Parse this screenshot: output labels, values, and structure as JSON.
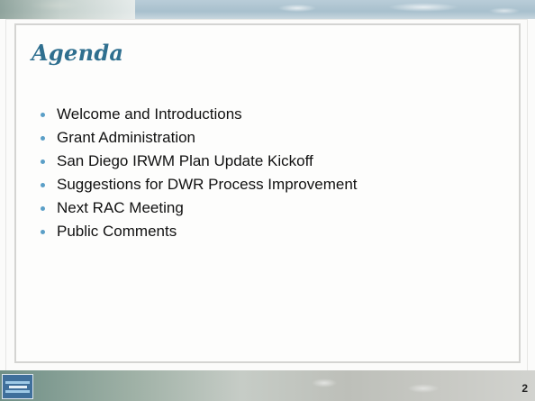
{
  "slide": {
    "title": "Agenda",
    "page_number": "2",
    "bullets": [
      "Welcome and Introductions",
      "Grant Administration",
      "San Diego IRWM Plan Update Kickoff",
      "Suggestions for DWR Process Improvement",
      "Next RAC Meeting",
      "Public Comments"
    ]
  },
  "colors": {
    "title": "#2f6f8f",
    "bullet_marker": "#5a9fc7",
    "text": "#111111"
  },
  "icons": {
    "bottom_logo": "regional-logo-icon",
    "bullet": "bullet-dot-icon"
  }
}
